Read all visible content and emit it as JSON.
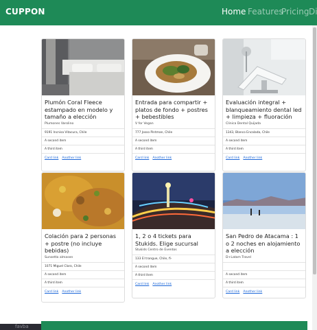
{
  "navbar": {
    "brand": "CUPPON",
    "links": [
      "Home",
      "Features",
      "Pricing",
      "Di"
    ]
  },
  "cards": [
    {
      "title": "Plumón Coral Fleece estampado en modelo y tamaño a elección",
      "subtitle": "Plumones Varolino",
      "address": "9191 Incnisa Vitacura, Chile",
      "item2": "A second item",
      "item3": "A third item",
      "link1": "Card link",
      "link2": "Another link",
      "image": "bedroom"
    },
    {
      "title": "Entrada para compartir + platos de fondo + postres + bebestibles",
      "subtitle": "V for Vegan",
      "address": "777 Josso Pintman, Chile",
      "item2": "A second item",
      "item3": "A third item",
      "link1": "Card link",
      "link2": "Another link",
      "image": "food-plate"
    },
    {
      "title": "Evaluación integral + blanqueamiento dental led + limpieza + fluoración",
      "subtitle": "Clinica Dental Quijada",
      "address": "1343, Blanco Encalada, Chile",
      "item2": "A second item",
      "item3": "A third item",
      "link1": "Card link",
      "link2": "Another link",
      "image": "dental-chair"
    },
    {
      "title": "Colación para 2 personas + postre (no incluye bebidas)",
      "subtitle": "Sunsetta almasen",
      "address": "1071 Miguel Claro, Chile",
      "item2": "A second item",
      "item3": "A third item",
      "link1": "Card link",
      "link2": "Another link",
      "image": "curry"
    },
    {
      "title": "1, 2 o 4 tickets para Stukids. Elige sucursal",
      "subtitle": "Stukids Centro de Eventos",
      "address": "133 El trangue, Chile, fi-",
      "item2": "A second item",
      "item3": "A third item",
      "link1": "Card link",
      "link2": "Another link",
      "image": "fair-lights"
    },
    {
      "title": "San Pedro de Atacama : 1 o 2 noches en alojamiento a elección",
      "subtitle": "D+Latam Travel",
      "address": "",
      "item2": "A second item",
      "item3": "A third item",
      "link1": "Card link",
      "link2": "Another link",
      "image": "atacama"
    }
  ],
  "taskbar": {
    "text": "favba"
  },
  "colors": {
    "primary": "#1e8a57",
    "link": "#1b66d8"
  }
}
